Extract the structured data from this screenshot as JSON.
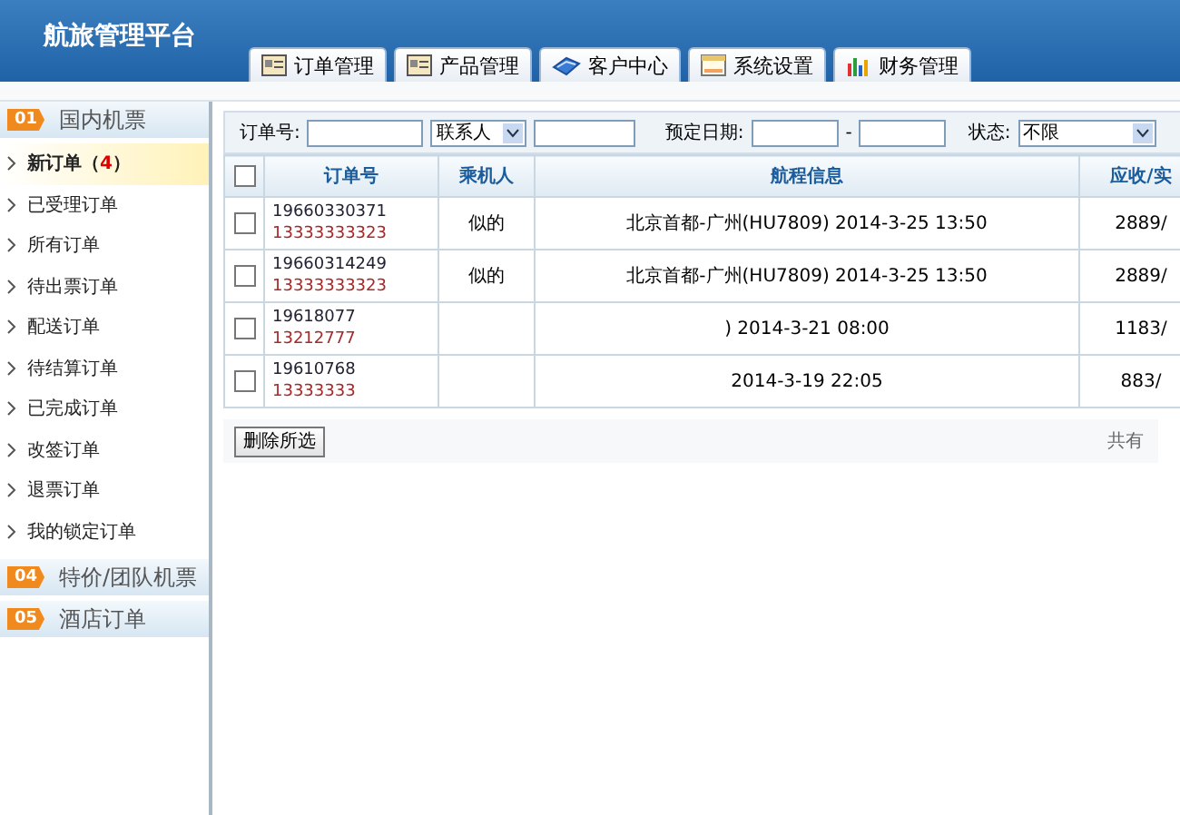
{
  "app": {
    "title": "航旅管理平台"
  },
  "tabs": [
    {
      "label": "订单管理",
      "kind": "ledger"
    },
    {
      "label": "产品管理",
      "kind": "ledger"
    },
    {
      "label": "客户中心",
      "kind": "book"
    },
    {
      "label": "系统设置",
      "kind": "window"
    },
    {
      "label": "财务管理",
      "kind": "chart"
    }
  ],
  "sidebar": {
    "sections": [
      {
        "badge": "01",
        "label": "国内机票",
        "items": [
          {
            "label": "新订单",
            "count_open": "（",
            "count": "4",
            "count_close": "）",
            "selected": true
          },
          {
            "label": "已受理订单",
            "selected": false
          },
          {
            "label": "所有订单",
            "selected": false
          },
          {
            "label": "待出票订单",
            "selected": false
          },
          {
            "label": "配送订单",
            "selected": false
          },
          {
            "label": "待结算订单",
            "selected": false
          },
          {
            "label": "已完成订单",
            "selected": false
          },
          {
            "label": "改签订单",
            "selected": false
          },
          {
            "label": "退票订单",
            "selected": false
          },
          {
            "label": "我的锁定订单",
            "selected": false
          }
        ]
      },
      {
        "badge": "04",
        "label": "特价/团队机票"
      },
      {
        "badge": "05",
        "label": "酒店订单"
      }
    ]
  },
  "filter": {
    "order_no_label": "订单号:",
    "contact_select": "联系人",
    "date_label": "预定日期:",
    "date_separator": "-",
    "status_label": "状态:",
    "status_select": "不限"
  },
  "table": {
    "columns": [
      "订单号",
      "乘机人",
      "航程信息",
      "应收/实"
    ],
    "select_all_checked": false,
    "rows": [
      {
        "checked": false,
        "order_no": "19660330371",
        "phone": "13333333323",
        "passenger": "似的",
        "route": "北京首都-广州(HU7809) 2014-3-25 13:50",
        "amount": "2889/"
      },
      {
        "checked": false,
        "order_no": "19660314249",
        "phone": "13333333323",
        "passenger": "似的",
        "route": "北京首都-广州(HU7809) 2014-3-25 13:50",
        "amount": "2889/"
      },
      {
        "checked": false,
        "order_no": "19618077",
        "phone": "13212777",
        "route": ") 2014-3-21 08:00",
        "amount": "1183/"
      },
      {
        "checked": false,
        "order_no": "19610768",
        "phone": "13333333",
        "route": "2014-3-19 22:05",
        "amount": "883/"
      }
    ]
  },
  "footer": {
    "delete_button": "删除所选",
    "pager": "共有"
  }
}
